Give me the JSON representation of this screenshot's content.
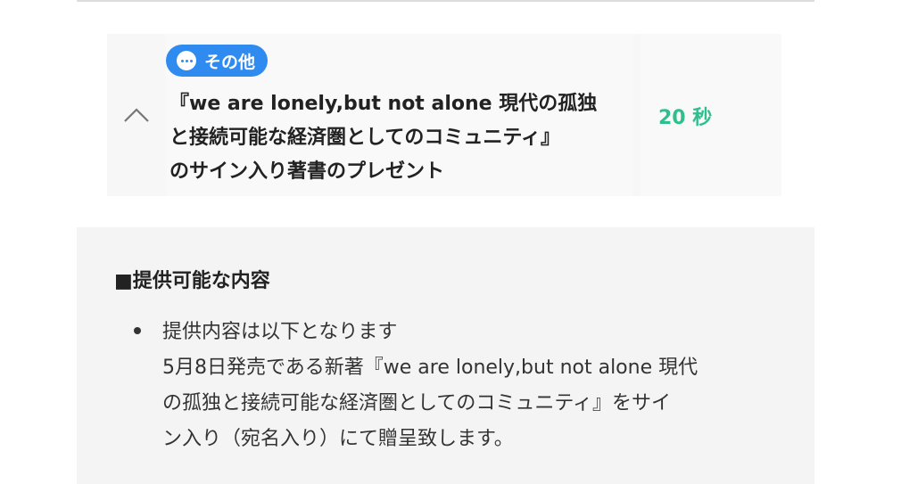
{
  "item": {
    "badge_label": "その他",
    "badge_icon": "ellipsis-icon",
    "title_lines": [
      "『we are lonely,but not alone 現代の孤独",
      "と接続可能な経済圏としてのコミュニティ』",
      "のサイン入り著書のプレゼント"
    ],
    "time": "20 秒"
  },
  "detail": {
    "heading": "■提供可能な内容",
    "lines": [
      "提供内容は以下となります",
      "5月8日発売である新著『we are lonely,but not alone 現代",
      "の孤独と接続可能な経済圏としてのコミュニティ』をサイ",
      "ン入り（宛名入り）にて贈呈致します。"
    ]
  },
  "colors": {
    "badge": "#2f8bf0",
    "time": "#2fbf8c",
    "panel": "#f4f4f5"
  }
}
